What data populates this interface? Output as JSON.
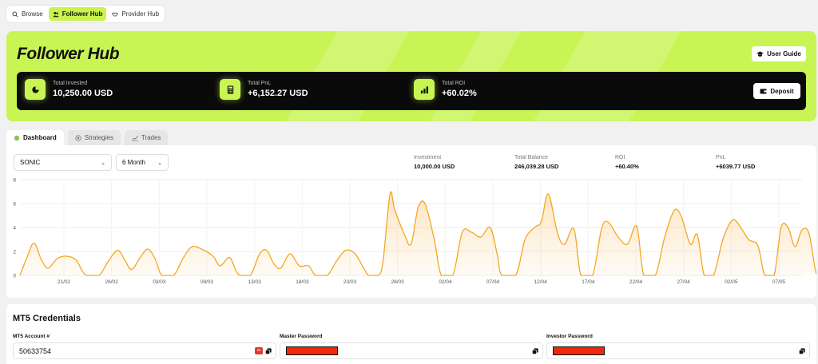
{
  "nav": {
    "items": [
      {
        "label": "Browse",
        "icon": "search-icon"
      },
      {
        "label": "Follower Hub",
        "icon": "users-icon",
        "active": true
      },
      {
        "label": "Provider Hub",
        "icon": "handshake-icon"
      }
    ]
  },
  "hero": {
    "title": "Follower Hub",
    "guide_label": "User Guide",
    "deposit_label": "Deposit",
    "stats": [
      {
        "label": "Total Invested",
        "value": "10,250.00 USD",
        "icon": "pie-chart-icon"
      },
      {
        "label": "Total PnL",
        "value": "+6,152.27 USD",
        "icon": "calculator-icon"
      },
      {
        "label": "Total ROI",
        "value": "+60.02%",
        "icon": "bar-chart-icon"
      }
    ],
    "accent": "#c8f553"
  },
  "tabs": [
    {
      "label": "Dashboard",
      "icon": "circle-icon",
      "active": true
    },
    {
      "label": "Strategies",
      "icon": "strategy-icon"
    },
    {
      "label": "Trades",
      "icon": "line-chart-icon"
    }
  ],
  "dashboard": {
    "strategy_select": "SONIC",
    "period_select": "6 Month",
    "metrics": [
      {
        "label": "Investment",
        "value": "10,000.00 USD"
      },
      {
        "label": "Total Balance",
        "value": "246,039.28 USD"
      },
      {
        "label": "ROI",
        "value": "+60.40%"
      },
      {
        "label": "PnL",
        "value": "+6039.77 USD"
      }
    ]
  },
  "chart_data": {
    "type": "area",
    "series_color": "#f5a623",
    "ylim": [
      0,
      8
    ],
    "yticks": [
      "8",
      "6",
      "4",
      "2",
      "0"
    ],
    "xticks": [
      "21/02",
      "26/02",
      "03/03",
      "08/03",
      "13/03",
      "18/03",
      "23/03",
      "28/03",
      "02/04",
      "07/04",
      "12/04",
      "17/04",
      "22/04",
      "27/04",
      "02/05",
      "07/05"
    ],
    "xrange": [
      0,
      168
    ],
    "points": [
      [
        0,
        0
      ],
      [
        1.5,
        1.5
      ],
      [
        3,
        2.7
      ],
      [
        4.5,
        1.4
      ],
      [
        6,
        0.6
      ],
      [
        8,
        1.4
      ],
      [
        10,
        1.6
      ],
      [
        12,
        1.3
      ],
      [
        13.5,
        0.3
      ],
      [
        14.5,
        0
      ],
      [
        17,
        0
      ],
      [
        19,
        1.2
      ],
      [
        21,
        2.1
      ],
      [
        22.5,
        1.3
      ],
      [
        24,
        0.5
      ],
      [
        26,
        1.6
      ],
      [
        27.5,
        2.2
      ],
      [
        29,
        1.4
      ],
      [
        30.5,
        0
      ],
      [
        33,
        0
      ],
      [
        35,
        1.4
      ],
      [
        37,
        2.4
      ],
      [
        39.5,
        2.1
      ],
      [
        41.5,
        1.6
      ],
      [
        43,
        0.8
      ],
      [
        45,
        1.5
      ],
      [
        46.5,
        0.3
      ],
      [
        47.5,
        0
      ],
      [
        49.5,
        0
      ],
      [
        51.5,
        1.8
      ],
      [
        53,
        2.1
      ],
      [
        54.5,
        1.0
      ],
      [
        56,
        0.6
      ],
      [
        58,
        1.8
      ],
      [
        60,
        0.8
      ],
      [
        62,
        0.8
      ],
      [
        63.5,
        0
      ],
      [
        66,
        0
      ],
      [
        68,
        1.2
      ],
      [
        70,
        2.1
      ],
      [
        72,
        1.8
      ],
      [
        74,
        0.5
      ],
      [
        75,
        0
      ],
      [
        77,
        0
      ],
      [
        78,
        1.2
      ],
      [
        79.5,
        6.8
      ],
      [
        80.5,
        5.5
      ],
      [
        82.5,
        3.5
      ],
      [
        84,
        2.6
      ],
      [
        85.5,
        5.6
      ],
      [
        87,
        6.0
      ],
      [
        89,
        3.0
      ],
      [
        90.5,
        0
      ],
      [
        93,
        0
      ],
      [
        95,
        3.6
      ],
      [
        97,
        3.6
      ],
      [
        99,
        3.2
      ],
      [
        101,
        4.0
      ],
      [
        102.5,
        1.8
      ],
      [
        103.5,
        0
      ],
      [
        106.5,
        0
      ],
      [
        108.5,
        3.0
      ],
      [
        110.5,
        4.0
      ],
      [
        112,
        4.5
      ],
      [
        113.5,
        6.8
      ],
      [
        115.5,
        3.5
      ],
      [
        117,
        2.6
      ],
      [
        119,
        3.9
      ],
      [
        120.5,
        0
      ],
      [
        123,
        0
      ],
      [
        125,
        4.0
      ],
      [
        126.5,
        4.4
      ],
      [
        128.5,
        3.2
      ],
      [
        130.5,
        2.6
      ],
      [
        132.5,
        4.1
      ],
      [
        134,
        0
      ],
      [
        136.5,
        0
      ],
      [
        138.5,
        3.2
      ],
      [
        140.5,
        5.4
      ],
      [
        142,
        5.0
      ],
      [
        144,
        2.6
      ],
      [
        145.5,
        3.4
      ],
      [
        147,
        0
      ],
      [
        149,
        0
      ],
      [
        151,
        3.0
      ],
      [
        153,
        4.6
      ],
      [
        154.5,
        4.2
      ],
      [
        156.5,
        3.0
      ],
      [
        158.5,
        2.5
      ],
      [
        160,
        0
      ],
      [
        162,
        0
      ],
      [
        163.5,
        4.0
      ],
      [
        165,
        4.0
      ],
      [
        166.5,
        2.4
      ],
      [
        168,
        3.8
      ],
      [
        169.5,
        3.5
      ],
      [
        171,
        0.2
      ],
      [
        172,
        0
      ]
    ]
  },
  "credentials": {
    "title": "MT5 Credentials",
    "account_label": "MT5 Account #",
    "account_value": "50633754",
    "master_label": "Master Password",
    "investor_label": "Investor Password"
  }
}
